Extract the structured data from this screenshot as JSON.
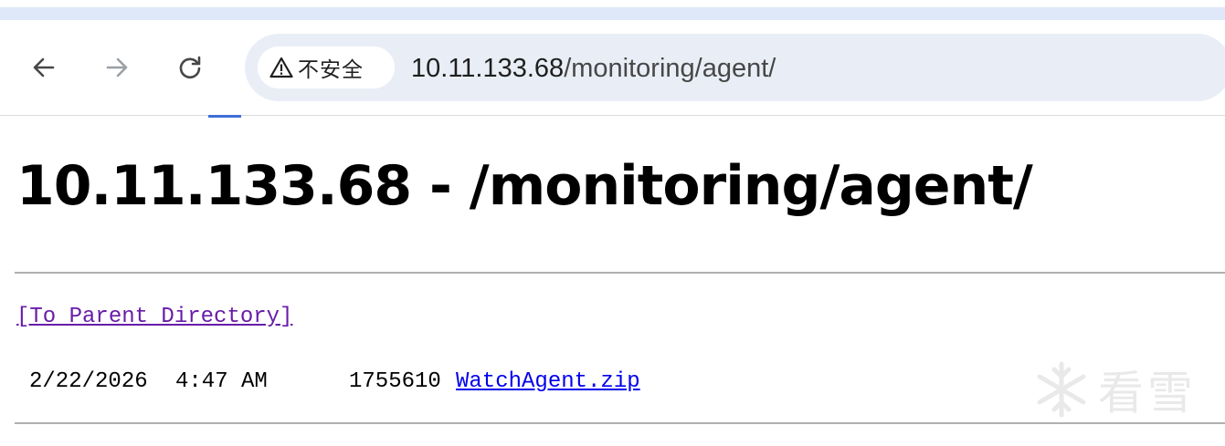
{
  "browser": {
    "nav": {
      "back_icon": "arrow-left-icon",
      "forward_icon": "arrow-right-icon",
      "reload_icon": "reload-icon"
    },
    "security_chip": {
      "icon": "warning-triangle-icon",
      "label": "不安全"
    },
    "address": {
      "host": "10.11.133.68",
      "path": "/monitoring/agent/"
    }
  },
  "page": {
    "title": "10.11.133.68 - /monitoring/agent/",
    "parent_link": "[To Parent Directory]",
    "entries": [
      {
        "date": "2/22/2026",
        "time": "4:47 AM",
        "size": "1755610",
        "name": "WatchAgent.zip"
      }
    ]
  },
  "watermark": {
    "text": "看雪",
    "icon": "snowflake-icon"
  },
  "colors": {
    "link_visited": "#681da8",
    "link": "#0000ee",
    "omnibox_bg": "#e9eef6",
    "tabstrip_bg": "#dee8f8"
  }
}
